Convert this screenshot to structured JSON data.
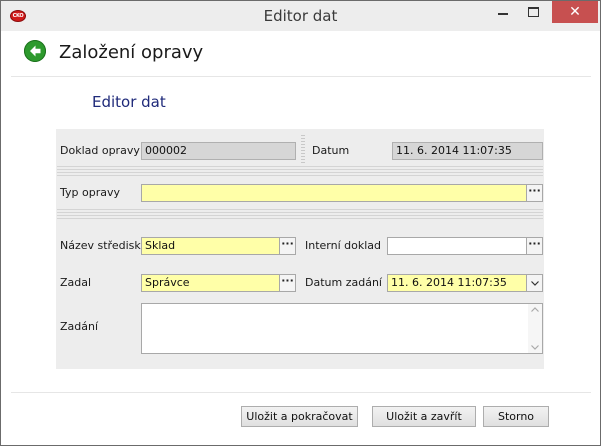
{
  "window": {
    "title": "Editor dat",
    "logo_text": "CKO",
    "close_glyph": "✕"
  },
  "header": {
    "back_icon": "back-arrow-icon",
    "title": "Založení opravy"
  },
  "section": {
    "title": "Editor dat"
  },
  "form": {
    "doklad_opravy": {
      "label": "Doklad opravy",
      "value": "000002"
    },
    "datum": {
      "label": "Datum",
      "value": "11. 6. 2014 11:07:35"
    },
    "typ_opravy": {
      "label": "Typ opravy",
      "value": ""
    },
    "nazev_strediska": {
      "label": "Název střediska",
      "value": "Sklad"
    },
    "interni_doklad": {
      "label": "Interní doklad",
      "value": ""
    },
    "zadal": {
      "label": "Zadal",
      "value": "Správce"
    },
    "datum_zadani": {
      "label": "Datum zadání",
      "value": "11. 6. 2014 11:07:35"
    },
    "zadani": {
      "label": "Zadání",
      "value": ""
    },
    "ellipsis": "···"
  },
  "buttons": {
    "save_continue": "Uložit a pokračovat",
    "save_close": "Uložit a zavřít",
    "cancel": "Storno"
  },
  "colors": {
    "required_bg": "#ffffa8",
    "readonly_bg": "#d6d6d6",
    "section_title": "#1f2a7a",
    "close_button": "#c75050",
    "back_button": "#2d9a2d"
  }
}
